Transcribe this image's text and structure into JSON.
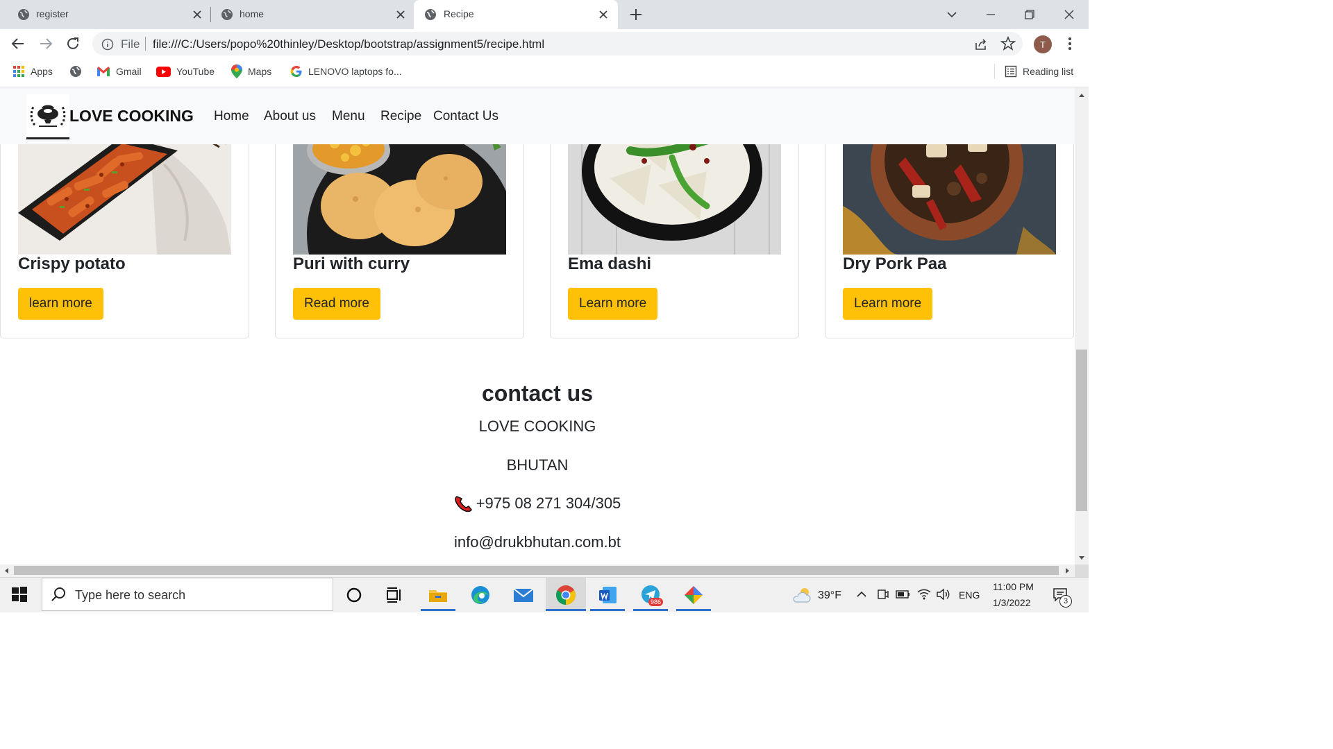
{
  "browser": {
    "tabs": [
      {
        "title": "register",
        "active": false
      },
      {
        "title": "home",
        "active": false
      },
      {
        "title": "Recipe",
        "active": true
      }
    ],
    "address_scheme": "File",
    "url": "file:///C:/Users/popo%20thinley/Desktop/bootstrap/assignment5/recipe.html",
    "avatar_letter": "T",
    "bookmarks": [
      {
        "label": "Apps",
        "icon": "apps-grid-icon"
      },
      {
        "label": "",
        "icon": "globe-icon"
      },
      {
        "label": "Gmail",
        "icon": "gmail-icon"
      },
      {
        "label": "YouTube",
        "icon": "youtube-icon"
      },
      {
        "label": "Maps",
        "icon": "maps-icon"
      },
      {
        "label": "LENOVO laptops fo...",
        "icon": "google-icon"
      }
    ],
    "reading_list": "Reading list"
  },
  "site": {
    "brand": "LOVE COOKING",
    "nav": [
      "Home",
      "About us",
      "Menu",
      "Recipe",
      "Contact Us"
    ],
    "cards": [
      {
        "title": "Crispy potato",
        "button": "learn more"
      },
      {
        "title": "Puri with curry",
        "button": "Read more"
      },
      {
        "title": "Ema dashi",
        "button": "Learn more"
      },
      {
        "title": "Dry Pork Paa",
        "button": "Learn more"
      }
    ],
    "contact": {
      "heading": "contact us",
      "name": "LOVE COOKING",
      "country": "BHUTAN",
      "phone": "+975 08 271 304/305",
      "email": "info@drukbhutan.com.bt"
    },
    "accent_color": "#ffc107"
  },
  "taskbar": {
    "search_placeholder": "Type here to search",
    "weather": "39°F",
    "language": "ENG",
    "time": "11:00 PM",
    "date": "1/3/2022",
    "telegram_badge": "986",
    "notification_count": "3"
  }
}
